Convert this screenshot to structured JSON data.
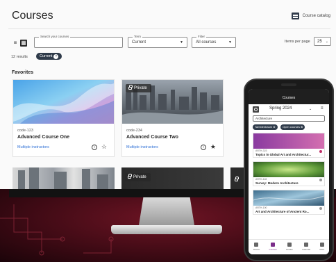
{
  "page": {
    "title": "Courses",
    "catalog_label": "Course catalog",
    "search": {
      "label": "Search your courses",
      "value": ""
    },
    "term": {
      "label": "Term",
      "value": "Current"
    },
    "filter": {
      "label": "Filter",
      "value": "All courses"
    },
    "items_per_page_label": "Items per page",
    "items_per_page_value": "25",
    "results_text": "12 results",
    "active_chip": "Current",
    "favorites_title": "Favorites",
    "cards": [
      {
        "code": "code-123",
        "name": "Advanced Course One",
        "instructors": "Multiple instructors",
        "starred": false,
        "private": false
      },
      {
        "code": "code-234",
        "name": "Advanced Course Two",
        "instructors": "Multiple instructors",
        "starred": true,
        "private": true,
        "private_label": "Private"
      }
    ],
    "row2_private_label": "Private"
  },
  "phone": {
    "header": "Courses",
    "term": "Spring 2024",
    "search_value": "Architecture",
    "chips": [
      "Tamblenbaum",
      "Open courses"
    ],
    "cards": [
      {
        "code": "ARTH-323",
        "name": "Topics in Global Art and Architectur...",
        "dot_color": "#c0306a"
      },
      {
        "code": "ARTH-118",
        "name": "Survey: Modern Architecture",
        "dot_color": "#9a9a9a"
      },
      {
        "code": "ARTH-100",
        "name": "Art and Architecture of Ancient Ro...",
        "dot_color": "#9a9a9a"
      }
    ],
    "nav": [
      "Stream",
      "Courses",
      "Grades",
      "Calendar",
      "More"
    ]
  }
}
